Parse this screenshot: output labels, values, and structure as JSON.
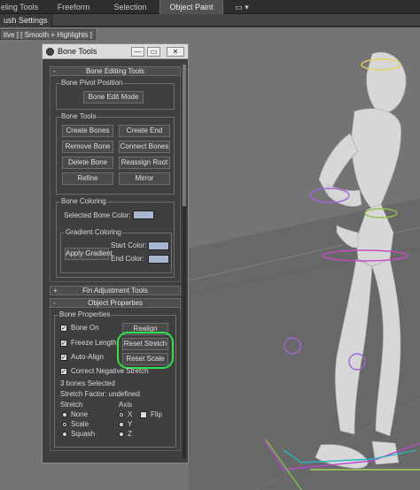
{
  "ribbon": {
    "tabs": [
      {
        "label": "eling Tools",
        "active": false
      },
      {
        "label": "Freeform",
        "active": false
      },
      {
        "label": "Selection",
        "active": false
      },
      {
        "label": "Object Paint",
        "active": true
      },
      {
        "label": "▭ ▾",
        "active": false
      }
    ],
    "brush_settings_label": "ush Settings"
  },
  "viewport": {
    "label": "tive ] [ Smooth + Highlights ]"
  },
  "bone_tools": {
    "title": "Bone Tools",
    "window_buttons": {
      "minimize": "—",
      "restore": "▭",
      "close": "✕"
    },
    "bone_editing": {
      "header": "Bone Editing Tools",
      "header_symbol": "-",
      "pivot_group": "Bone Pivot Position",
      "bone_edit_mode": "Bone Edit Mode",
      "bone_tools_group": "Bone Tools",
      "create_bones": "Create Bones",
      "create_end": "Create End",
      "remove_bone": "Remove Bone",
      "connect_bones": "Connect Bones",
      "delete_bone": "Delete Bone",
      "reassign_root": "Reassign Root",
      "refine": "Refine",
      "mirror": "Mirror",
      "coloring_group": "Bone Coloring",
      "selected_bone_color": "Selected Bone Color:",
      "gradient_group": "Gradient Coloring",
      "apply_gradient": "Apply Gradient",
      "start_color": "Start Color:",
      "end_color": "End Color:"
    },
    "fin_adjustment": {
      "header": "Fin Adjustment Tools",
      "header_symbol": "+"
    },
    "object_properties": {
      "header": "Object Properties",
      "header_symbol": "-",
      "group": "Bone Properties",
      "bone_on": {
        "label": "Bone On",
        "checked": true
      },
      "freeze_length": {
        "label": "Freeze Length",
        "checked": true
      },
      "auto_align": {
        "label": "Auto-Align",
        "checked": true
      },
      "correct_negative_stretch": {
        "label": "Correct Negative Stretch",
        "checked": true
      },
      "realign": "Realign",
      "reset_stretch": "Reset Stretch",
      "reset_scale": "Reset Scale",
      "bones_selected": "3 bones Selected",
      "stretch_factor": "Stretch Factor: undefined",
      "stretch_title": "Stretch",
      "stretch_options": [
        {
          "label": "None",
          "selected": false
        },
        {
          "label": "Scale",
          "selected": true
        },
        {
          "label": "Squash",
          "selected": false
        }
      ],
      "axis_title": "Axis",
      "axis_options": [
        {
          "label": "X",
          "selected": true
        },
        {
          "label": "Y",
          "selected": false
        },
        {
          "label": "Z",
          "selected": false
        }
      ],
      "flip": {
        "label": "Flip",
        "checked": false
      }
    }
  },
  "colors": {
    "selected_bone_color": "#a7b7d1",
    "start_color": "#a7b7d1",
    "end_color": "#a7b7d1",
    "annotation_highlight": "#2fe34a"
  }
}
